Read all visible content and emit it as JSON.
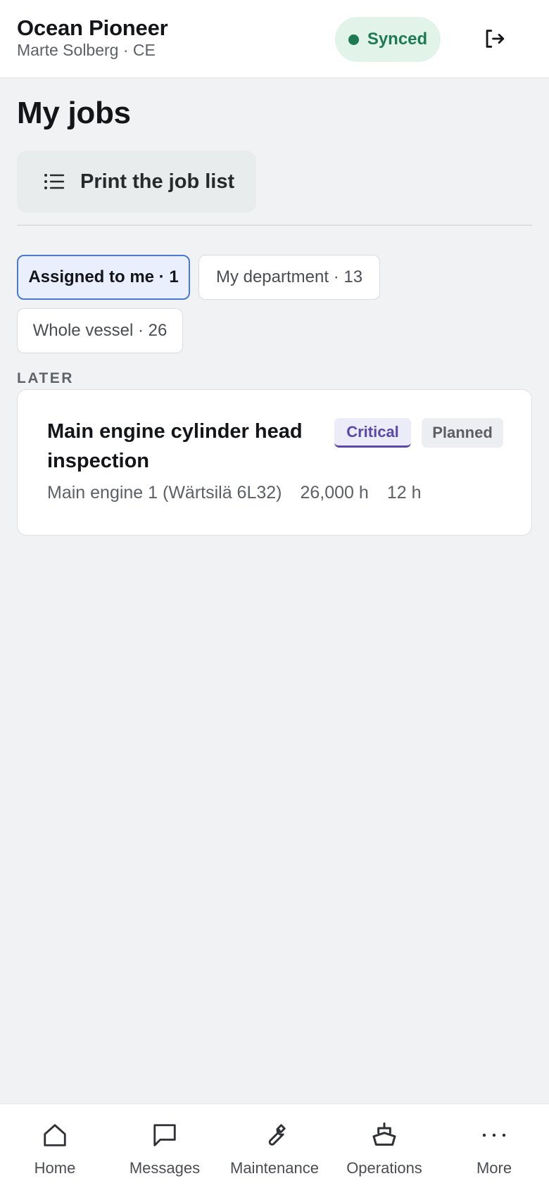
{
  "header": {
    "vessel_name": "Ocean Pioneer",
    "user_line": "Marte Solberg · CE",
    "sync_status": "Synced",
    "sync_color": "#1d7a52",
    "logout_icon": "logout-icon"
  },
  "main": {
    "title": "My jobs",
    "print_button": {
      "label": "Print the job list",
      "icon": "list-icon"
    },
    "filters": [
      {
        "label": "Assigned to me · 1",
        "active": true
      },
      {
        "label": "My department · 13",
        "active": false
      },
      {
        "label": "Whole vessel · 26",
        "active": false
      }
    ],
    "sections": [
      {
        "label": "LATER",
        "jobs": [
          {
            "title": "Main engine cylinder head inspection",
            "tags": [
              "Critical",
              "Planned"
            ],
            "component": "Main engine 1 (Wärtsilä 6L32)",
            "interval": "26,000 h",
            "duration": "12 h"
          }
        ]
      }
    ]
  },
  "bottom_nav": {
    "items": [
      {
        "label": "Home",
        "icon": "home-icon"
      },
      {
        "label": "Messages",
        "icon": "message-icon"
      },
      {
        "label": "Maintenance",
        "icon": "wrench-icon"
      },
      {
        "label": "Operations",
        "icon": "ship-icon"
      },
      {
        "label": "More",
        "icon": "more-icon"
      }
    ]
  },
  "colors": {
    "accent": "#4a78d6",
    "critical": "#5b48a8",
    "background": "#f1f2f4"
  }
}
